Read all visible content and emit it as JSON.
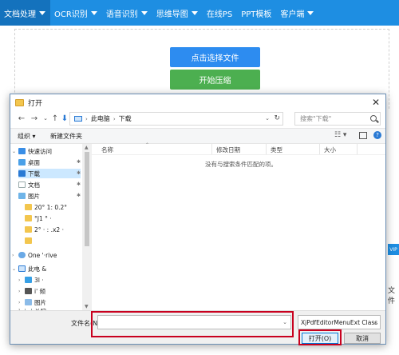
{
  "topnav": {
    "items": [
      {
        "label": "文档处理",
        "dropdown": true
      },
      {
        "label": "OCR识别",
        "dropdown": true
      },
      {
        "label": "语音识别",
        "dropdown": true
      },
      {
        "label": "思维导图",
        "dropdown": true
      },
      {
        "label": "在线PS",
        "dropdown": false
      },
      {
        "label": "PPT模板",
        "dropdown": false
      },
      {
        "label": "客户端",
        "dropdown": true
      }
    ],
    "bg_color": "#1e8ee2"
  },
  "page": {
    "select_file_button": "点击选择文件",
    "start_compress_button": "开始压缩",
    "side_tab": "VIP",
    "side_text": "文件"
  },
  "dialog": {
    "title": "打开",
    "close_symbol": "✕",
    "address": {
      "crumbs": [
        "此电脑",
        "下载"
      ],
      "search_placeholder": "搜索\"下载\""
    },
    "toolbar": {
      "organize": "组织 ▾",
      "new_folder": "新建文件夹"
    },
    "nav_items": [
      {
        "label": "快速访问",
        "icon": "star-icon"
      },
      {
        "label": "桌面",
        "icon": "desktop-icon"
      },
      {
        "label": "下载",
        "icon": "download-icon"
      },
      {
        "label": "文档",
        "icon": "document-icon"
      },
      {
        "label": "图片",
        "icon": "picture-icon"
      },
      {
        "label": "20° 1: 0.2°",
        "icon": "folder-icon"
      },
      {
        "label": "°J1 ° ·",
        "icon": "folder-icon"
      },
      {
        "label": "2° · : .x2 ·",
        "icon": "folder-icon"
      },
      {
        "label": "",
        "icon": "folder-icon"
      },
      {
        "label": "One '·rive",
        "icon": "cloud-icon"
      },
      {
        "label": "此电 &",
        "icon": "pc-icon"
      },
      {
        "label": "3I ·",
        "icon": "3d-objects-icon"
      },
      {
        "label": "i' 频",
        "icon": "video-icon"
      },
      {
        "label": "图片",
        "icon": "picture-icon"
      },
      {
        "label": "文档",
        "icon": "document-icon"
      }
    ],
    "columns": [
      "名称",
      "修改日期",
      "类型",
      "大小"
    ],
    "empty_message": "没有与搜索条件匹配的项。",
    "filename_label": "文件名(N):",
    "filename_value": "",
    "filetype_value": "XjPdfEditorMenuExt Class",
    "open_button": "打开(O)",
    "cancel_button": "取消",
    "highlight_color": "#c8001e"
  }
}
